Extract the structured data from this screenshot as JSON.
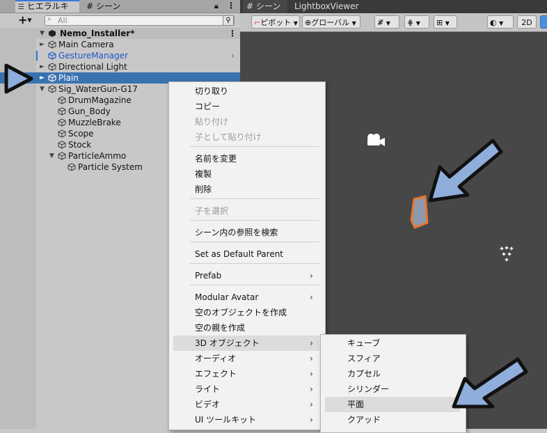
{
  "hierarchy": {
    "tab_hierarchy": "ヒエラルキー",
    "tab_scene": "シーン",
    "add_label": "+",
    "search_placeholder": "All",
    "root": "Nemo_Installer*",
    "items": [
      {
        "label": "Main Camera"
      },
      {
        "label": "GestureManager"
      },
      {
        "label": "Directional Light"
      },
      {
        "label": "Plain"
      },
      {
        "label": "Sig_WaterGun-G17"
      },
      {
        "label": "DrumMagazine"
      },
      {
        "label": "Gun_Body"
      },
      {
        "label": "MuzzleBrake"
      },
      {
        "label": "Scope"
      },
      {
        "label": "Stock"
      },
      {
        "label": "ParticleAmmo"
      },
      {
        "label": "Particle System"
      }
    ]
  },
  "scene": {
    "tab_scene": "シーン",
    "tab_lightbox": "LightboxViewer",
    "pivot": "ピボット",
    "global": "グローバル",
    "mode_2d": "2D"
  },
  "context_menu": {
    "items": [
      {
        "label": "切り取り",
        "disabled": false
      },
      {
        "label": "コピー",
        "disabled": false
      },
      {
        "label": "貼り付け",
        "disabled": true
      },
      {
        "label": "子として貼り付け",
        "disabled": true
      },
      {
        "label": "名前を変更",
        "disabled": false
      },
      {
        "label": "複製",
        "disabled": false
      },
      {
        "label": "削除",
        "disabled": false
      },
      {
        "label": "子を選択",
        "disabled": true
      },
      {
        "label": "シーン内の参照を検索",
        "disabled": false
      },
      {
        "label": "Set as Default Parent",
        "disabled": false
      },
      {
        "label": "Prefab",
        "disabled": false
      },
      {
        "label": "Modular Avatar",
        "disabled": false
      },
      {
        "label": "空のオブジェクトを作成",
        "disabled": false
      },
      {
        "label": "空の親を作成",
        "disabled": false
      },
      {
        "label": "3D オブジェクト",
        "disabled": false
      },
      {
        "label": "オーディオ",
        "disabled": false
      },
      {
        "label": "エフェクト",
        "disabled": false
      },
      {
        "label": "ライト",
        "disabled": false
      },
      {
        "label": "ビデオ",
        "disabled": false
      },
      {
        "label": "UI ツールキット",
        "disabled": false
      }
    ]
  },
  "submenu_3d": {
    "items": [
      {
        "label": "キューブ"
      },
      {
        "label": "スフィア"
      },
      {
        "label": "カプセル"
      },
      {
        "label": "シリンダー"
      },
      {
        "label": "平面"
      },
      {
        "label": "クアッド"
      }
    ]
  },
  "colors": {
    "selection": "#3a72b0",
    "link_blue": "#1a56c8",
    "annotation_arrow": "#8faedc",
    "gizmo_orange": "#e8772e"
  }
}
